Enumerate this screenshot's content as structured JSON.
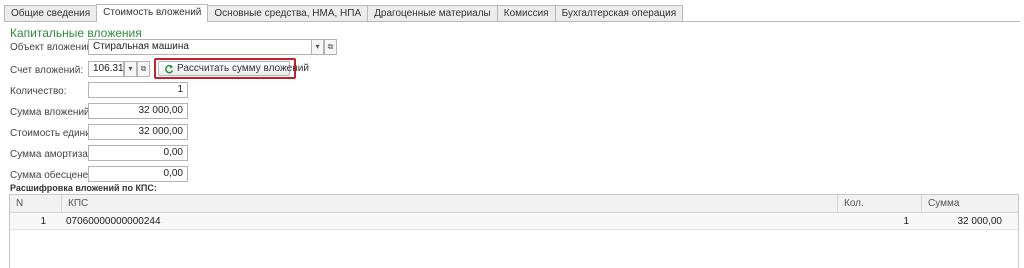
{
  "tabs": [
    {
      "label": "Общие сведения"
    },
    {
      "label": "Стоимость вложений"
    },
    {
      "label": "Основные средства, НМА, НПА"
    },
    {
      "label": "Драгоценные материалы"
    },
    {
      "label": "Комиссия"
    },
    {
      "label": "Бухгалтерская операция"
    }
  ],
  "active_tab": "Стоимость вложений",
  "section_title": "Капитальные вложения",
  "form": {
    "object_label": "Объект вложений:",
    "object_value": "Стиральная машина",
    "account_label": "Счет вложений:",
    "account_value": "106.31",
    "calc_button": "Рассчитать сумму вложений",
    "quantity_label": "Количество:",
    "quantity_value": "1",
    "sum_label": "Сумма вложений:",
    "sum_value": "32 000,00",
    "unit_cost_label": "Стоимость единицы:",
    "unit_cost_value": "32 000,00",
    "amort_label": "Сумма амортизации:",
    "amort_value": "0,00",
    "impair_label": "Сумма обесценения:",
    "impair_value": "0,00"
  },
  "breakdown_title": "Расшифровка вложений по КПС:",
  "table": {
    "columns": [
      "N",
      "КПС",
      "Кол.",
      "Сумма"
    ],
    "rows": [
      {
        "n": "1",
        "kps": "07060000000000244",
        "qty": "1",
        "sum": "32 000,00"
      }
    ]
  },
  "icons": {
    "dropdown": "chevron-down-icon",
    "open": "open-link-icon",
    "refresh": "refresh-icon"
  },
  "colors": {
    "section_title": "#2e8b3a",
    "highlight_border": "#c0212a"
  }
}
